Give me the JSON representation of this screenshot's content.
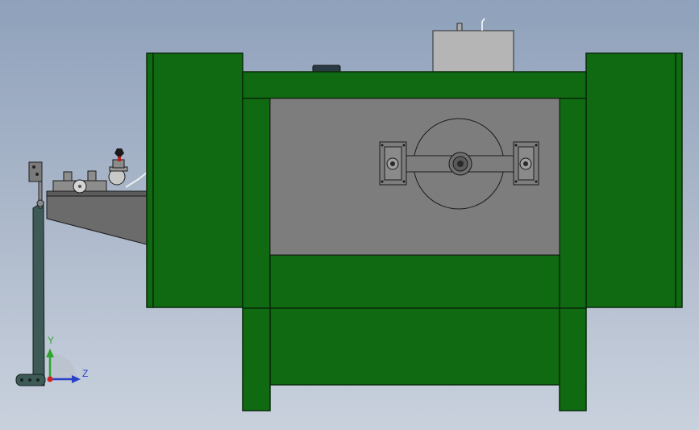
{
  "viewport": {
    "title": "",
    "colors": {
      "background_top": "#8fa1bb",
      "background_bottom": "#c9d1dd",
      "frame_green": "#0f6a12",
      "frame_edge": "#0a2a0a",
      "panel_gray": "#7d7d7d",
      "motor_box": "#b5b5b5",
      "feeder_gray": "#6b6b6b",
      "stand_teal": "#3d5a56"
    }
  },
  "triad": {
    "y_label": "Y",
    "z_label": "Z",
    "y_color": "#2fa52f",
    "z_color": "#2840c8",
    "origin_color": "#d02020"
  }
}
